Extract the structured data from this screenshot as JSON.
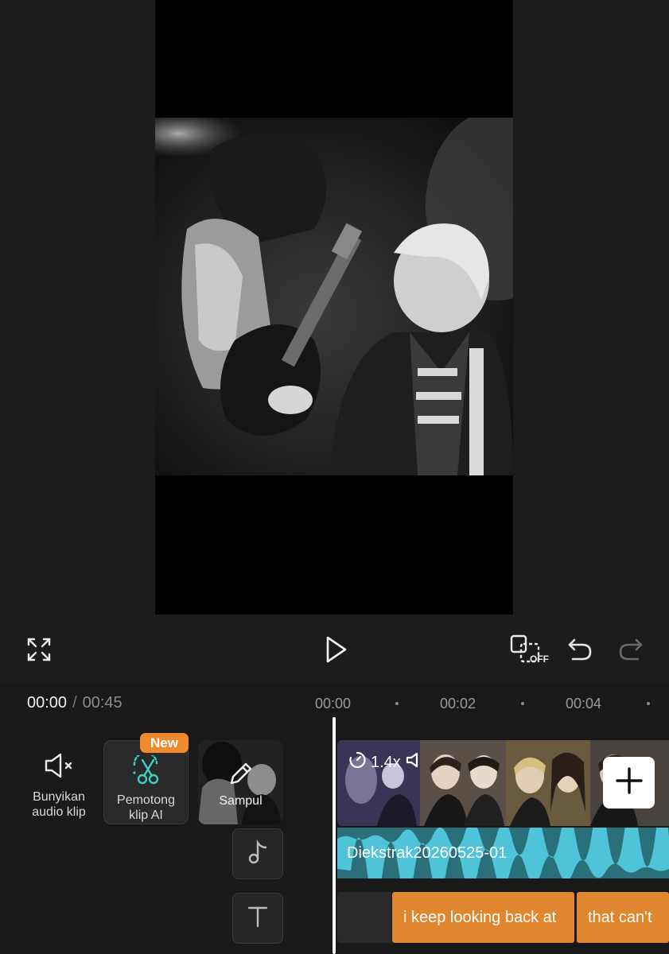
{
  "player": {
    "captions_toggle_state": "OFF"
  },
  "timeline": {
    "current_time": "00:00",
    "separator": "/",
    "total_time": "00:45",
    "ruler": [
      "00:00",
      "00:02",
      "00:04"
    ]
  },
  "tools": {
    "mute": {
      "label": "Bunyikan audio klip"
    },
    "ai_cut": {
      "label": "Pemotong klip AI",
      "badge": "New"
    },
    "cover": {
      "label": "Sampul"
    }
  },
  "tracks": {
    "video": {
      "speed": "1.4x"
    },
    "audio": {
      "name": "Diekstrak20260525-01"
    },
    "text_clips": [
      "i keep looking back at",
      "that can't"
    ]
  },
  "colors": {
    "accent_orange": "#e0862f",
    "audio_teal": "#2b6f7b",
    "ai_icon_teal": "#3fd0c4",
    "badge_orange": "#f08a2c"
  }
}
